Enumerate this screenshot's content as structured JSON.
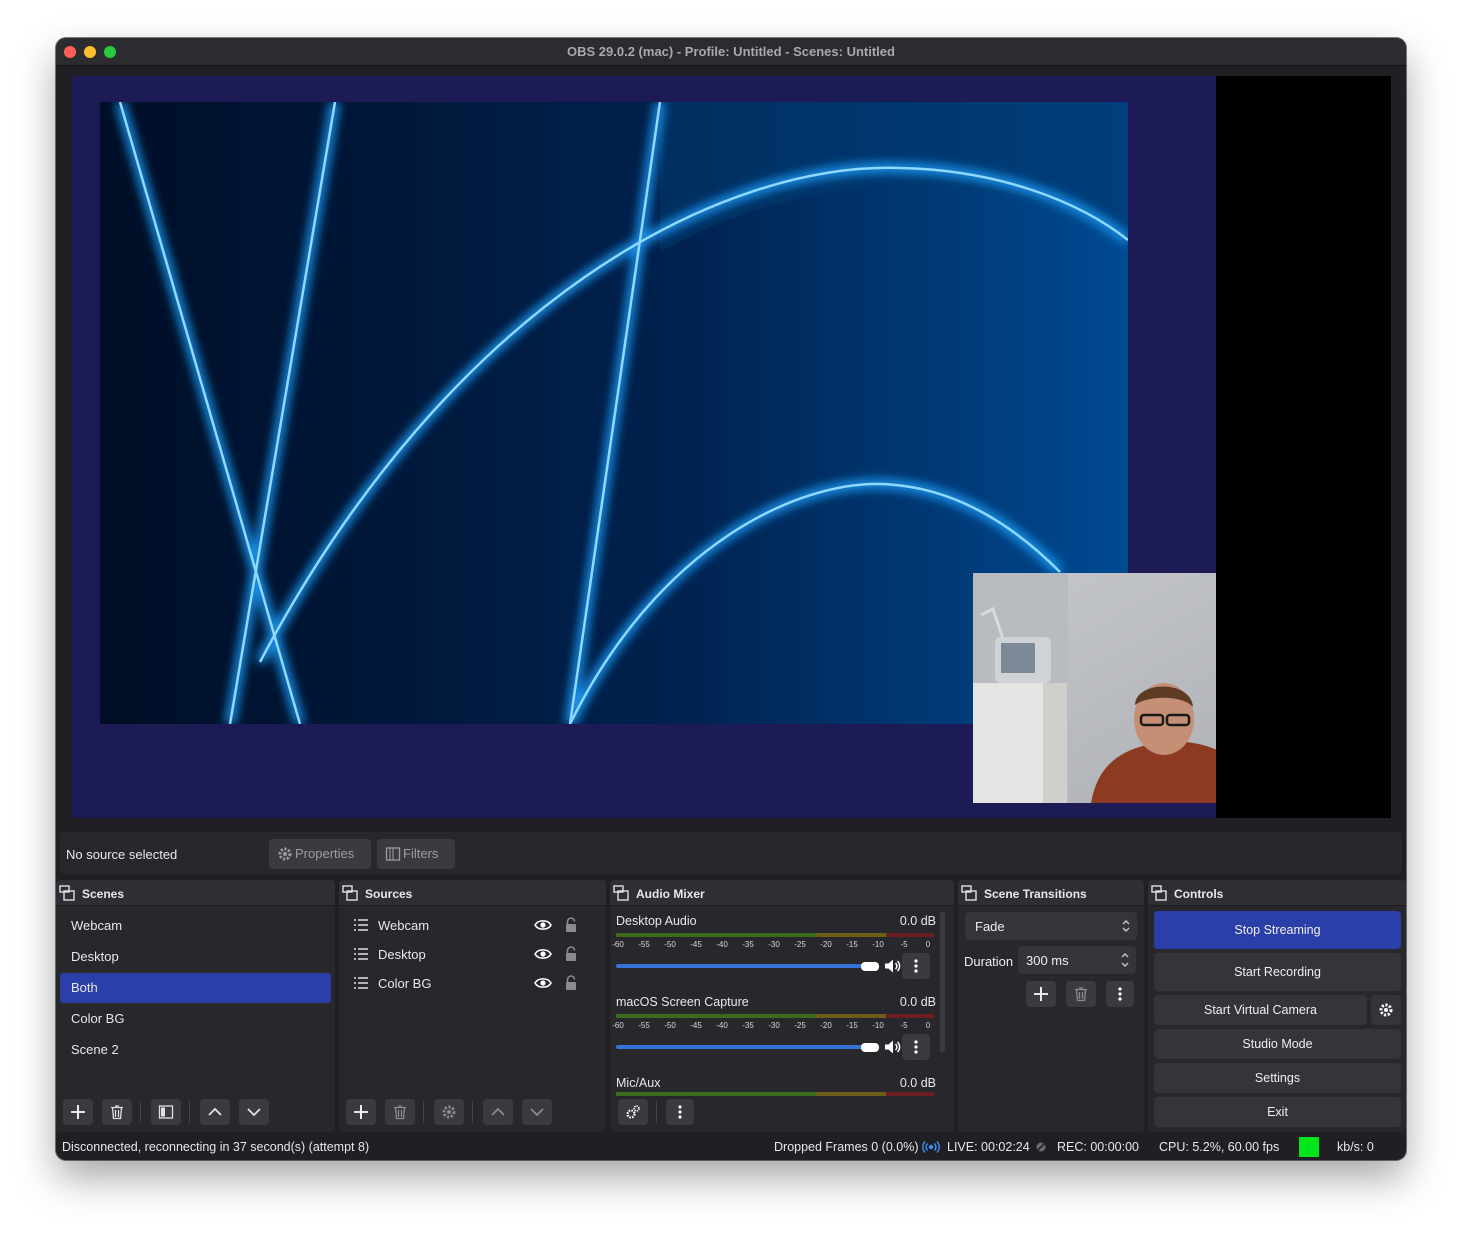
{
  "window": {
    "title": "OBS 29.0.2 (mac) - Profile: Untitled - Scenes: Untitled"
  },
  "toolbar": {
    "no_source": "No source selected",
    "properties": "Properties",
    "filters": "Filters"
  },
  "scenes": {
    "title": "Scenes",
    "items": [
      {
        "label": "Webcam",
        "active": false
      },
      {
        "label": "Desktop",
        "active": false
      },
      {
        "label": "Both",
        "active": true
      },
      {
        "label": "Color BG",
        "active": false
      },
      {
        "label": "Scene 2",
        "active": false
      }
    ]
  },
  "sources": {
    "title": "Sources",
    "items": [
      {
        "label": "Webcam"
      },
      {
        "label": "Desktop"
      },
      {
        "label": "Color BG"
      }
    ]
  },
  "mixer": {
    "title": "Audio Mixer",
    "channels": [
      {
        "name": "Desktop Audio",
        "db": "0.0 dB"
      },
      {
        "name": "macOS Screen Capture",
        "db": "0.0 dB"
      },
      {
        "name": "Mic/Aux",
        "db": "0.0 dB"
      }
    ],
    "ticks": [
      "-60",
      "-55",
      "-50",
      "-45",
      "-40",
      "-35",
      "-30",
      "-25",
      "-20",
      "-15",
      "-10",
      "-5",
      "0"
    ]
  },
  "transitions": {
    "title": "Scene Transitions",
    "selected": "Fade",
    "duration_label": "Duration",
    "duration_value": "300 ms"
  },
  "controls": {
    "title": "Controls",
    "stop_streaming": "Stop Streaming",
    "start_recording": "Start Recording",
    "start_virtual_camera": "Start Virtual Camera",
    "studio_mode": "Studio Mode",
    "settings": "Settings",
    "exit": "Exit"
  },
  "status": {
    "connection": "Disconnected, reconnecting in 37 second(s) (attempt 8)",
    "dropped_frames": "Dropped Frames 0 (0.0%)",
    "live": "LIVE: 00:02:24",
    "rec": "REC: 00:00:00",
    "cpu": "CPU: 5.2%, 60.00 fps",
    "kbs": "kb/s: 0"
  },
  "colors": {
    "accent": "#2b3fa8",
    "canvas_bg": "#1d1b55",
    "kbs_indicator": "#00e61a"
  }
}
